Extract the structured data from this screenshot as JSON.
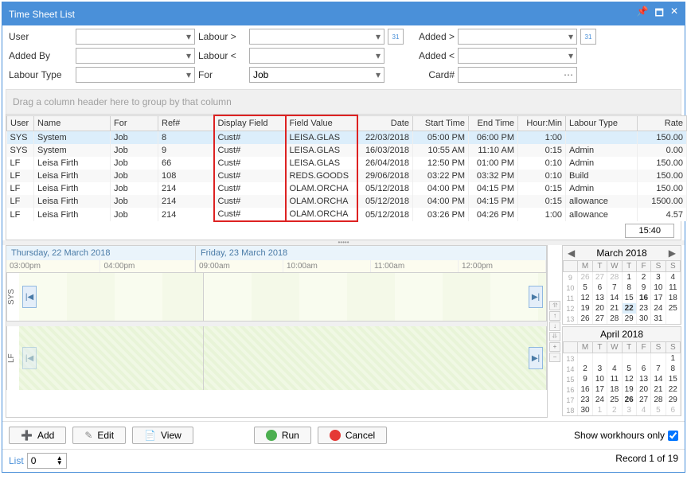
{
  "title": "Time Sheet List",
  "filters": {
    "user_label": "User",
    "labour_gt_label": "Labour >",
    "added_gt_label": "Added >",
    "added_by_label": "Added By",
    "labour_lt_label": "Labour <",
    "added_lt_label": "Added <",
    "labour_type_label": "Labour Type",
    "for_label": "For",
    "for_value": "Job",
    "card_label": "Card#"
  },
  "group_prompt": "Drag a column header here to group by that column",
  "columns": {
    "user": "User",
    "name": "Name",
    "for": "For",
    "ref": "Ref#",
    "display_field": "Display Field",
    "field_value": "Field Value",
    "date": "Date",
    "start_time": "Start Time",
    "end_time": "End Time",
    "hour_min": "Hour:Min",
    "labour_type": "Labour Type",
    "rate": "Rate"
  },
  "rows": [
    {
      "user": "SYS",
      "name": "System",
      "for": "Job",
      "ref": "8",
      "display_field": "Cust#",
      "field_value": "LEISA.GLAS",
      "date": "22/03/2018",
      "start": "05:00 PM",
      "end": "06:00 PM",
      "hm": "1:00",
      "ltype": "",
      "rate": "150.00",
      "sel": true
    },
    {
      "user": "SYS",
      "name": "System",
      "for": "Job",
      "ref": "9",
      "display_field": "Cust#",
      "field_value": "LEISA.GLAS",
      "date": "16/03/2018",
      "start": "10:55 AM",
      "end": "11:10 AM",
      "hm": "0:15",
      "ltype": "Admin",
      "rate": "0.00"
    },
    {
      "user": "LF",
      "name": "Leisa Firth",
      "for": "Job",
      "ref": "66",
      "display_field": "Cust#",
      "field_value": "LEISA.GLAS",
      "date": "26/04/2018",
      "start": "12:50 PM",
      "end": "01:00 PM",
      "hm": "0:10",
      "ltype": "Admin",
      "rate": "150.00"
    },
    {
      "user": "LF",
      "name": "Leisa Firth",
      "for": "Job",
      "ref": "108",
      "display_field": "Cust#",
      "field_value": "REDS.GOODS",
      "date": "29/06/2018",
      "start": "03:22 PM",
      "end": "03:32 PM",
      "hm": "0:10",
      "ltype": "Build",
      "rate": "150.00"
    },
    {
      "user": "LF",
      "name": "Leisa Firth",
      "for": "Job",
      "ref": "214",
      "display_field": "Cust#",
      "field_value": "OLAM.ORCHA",
      "date": "05/12/2018",
      "start": "04:00 PM",
      "end": "04:15 PM",
      "hm": "0:15",
      "ltype": "Admin",
      "rate": "150.00"
    },
    {
      "user": "LF",
      "name": "Leisa Firth",
      "for": "Job",
      "ref": "214",
      "display_field": "Cust#",
      "field_value": "OLAM.ORCHA",
      "date": "05/12/2018",
      "start": "04:00 PM",
      "end": "04:15 PM",
      "hm": "0:15",
      "ltype": "allowance",
      "rate": "1500.00"
    },
    {
      "user": "LF",
      "name": "Leisa Firth",
      "for": "Job",
      "ref": "214",
      "display_field": "Cust#",
      "field_value": "OLAM.ORCHA",
      "date": "05/12/2018",
      "start": "03:26 PM",
      "end": "04:26 PM",
      "hm": "1:00",
      "ltype": "allowance",
      "rate": "4.57"
    }
  ],
  "footer_total": "15:40",
  "schedule": {
    "day1": {
      "title": "Thursday, 22 March 2018",
      "times": [
        "03:00pm",
        "04:00pm"
      ]
    },
    "day2": {
      "title": "Friday, 23 March 2018",
      "times": [
        "09:00am",
        "10:00am",
        "11:00am",
        "12:00pm"
      ]
    },
    "label1": "SYS",
    "label2": "LF"
  },
  "calendar1": {
    "title": "March 2018",
    "dow": [
      "M",
      "T",
      "W",
      "T",
      "F",
      "S",
      "S"
    ],
    "weeks": [
      {
        "wk": "9",
        "days": [
          {
            "d": "26",
            "o": true
          },
          {
            "d": "27",
            "o": true
          },
          {
            "d": "28",
            "o": true
          },
          {
            "d": "1"
          },
          {
            "d": "2"
          },
          {
            "d": "3"
          },
          {
            "d": "4"
          }
        ]
      },
      {
        "wk": "10",
        "days": [
          {
            "d": "5"
          },
          {
            "d": "6"
          },
          {
            "d": "7"
          },
          {
            "d": "8"
          },
          {
            "d": "9"
          },
          {
            "d": "10"
          },
          {
            "d": "11"
          }
        ]
      },
      {
        "wk": "11",
        "days": [
          {
            "d": "12"
          },
          {
            "d": "13"
          },
          {
            "d": "14"
          },
          {
            "d": "15"
          },
          {
            "d": "16",
            "b": true
          },
          {
            "d": "17"
          },
          {
            "d": "18"
          }
        ]
      },
      {
        "wk": "12",
        "days": [
          {
            "d": "19"
          },
          {
            "d": "20"
          },
          {
            "d": "21"
          },
          {
            "d": "22",
            "b": true,
            "s": true
          },
          {
            "d": "23"
          },
          {
            "d": "24"
          },
          {
            "d": "25"
          }
        ]
      },
      {
        "wk": "13",
        "days": [
          {
            "d": "26"
          },
          {
            "d": "27"
          },
          {
            "d": "28"
          },
          {
            "d": "29"
          },
          {
            "d": "30"
          },
          {
            "d": "31"
          },
          {
            "d": ""
          }
        ]
      }
    ]
  },
  "calendar2": {
    "title": "April 2018",
    "dow": [
      "M",
      "T",
      "W",
      "T",
      "F",
      "S",
      "S"
    ],
    "weeks": [
      {
        "wk": "13",
        "days": [
          {
            "d": ""
          },
          {
            "d": ""
          },
          {
            "d": ""
          },
          {
            "d": ""
          },
          {
            "d": ""
          },
          {
            "d": ""
          },
          {
            "d": "1"
          }
        ]
      },
      {
        "wk": "14",
        "days": [
          {
            "d": "2"
          },
          {
            "d": "3"
          },
          {
            "d": "4"
          },
          {
            "d": "5"
          },
          {
            "d": "6"
          },
          {
            "d": "7"
          },
          {
            "d": "8"
          }
        ]
      },
      {
        "wk": "15",
        "days": [
          {
            "d": "9"
          },
          {
            "d": "10"
          },
          {
            "d": "11"
          },
          {
            "d": "12"
          },
          {
            "d": "13"
          },
          {
            "d": "14"
          },
          {
            "d": "15"
          }
        ]
      },
      {
        "wk": "16",
        "days": [
          {
            "d": "16"
          },
          {
            "d": "17"
          },
          {
            "d": "18"
          },
          {
            "d": "19"
          },
          {
            "d": "20"
          },
          {
            "d": "21"
          },
          {
            "d": "22"
          }
        ]
      },
      {
        "wk": "17",
        "days": [
          {
            "d": "23"
          },
          {
            "d": "24"
          },
          {
            "d": "25"
          },
          {
            "d": "26",
            "b": true
          },
          {
            "d": "27"
          },
          {
            "d": "28"
          },
          {
            "d": "29"
          }
        ]
      },
      {
        "wk": "18",
        "days": [
          {
            "d": "30"
          },
          {
            "d": "1",
            "o": true
          },
          {
            "d": "2",
            "o": true
          },
          {
            "d": "3",
            "o": true
          },
          {
            "d": "4",
            "o": true
          },
          {
            "d": "5",
            "o": true
          },
          {
            "d": "6",
            "o": true
          }
        ]
      }
    ]
  },
  "buttons": {
    "add": "Add",
    "edit": "Edit",
    "view": "View",
    "run": "Run",
    "cancel": "Cancel",
    "workhours": "Show workhours only"
  },
  "status": {
    "list": "List",
    "list_value": "0",
    "record": "Record 1 of 19"
  }
}
